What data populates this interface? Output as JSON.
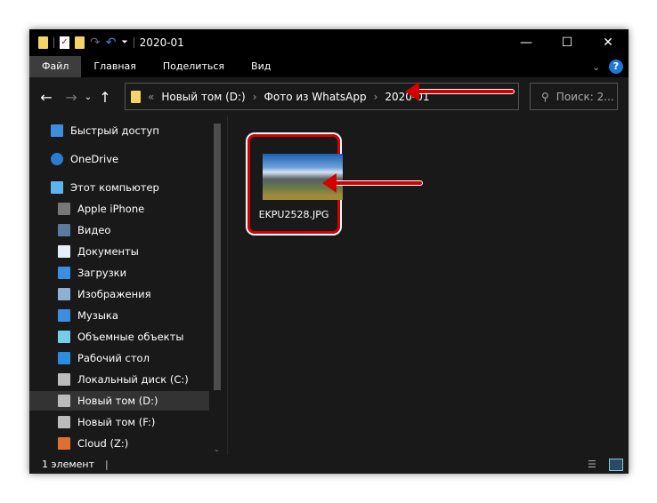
{
  "window": {
    "title": "2020-01",
    "minimize": "—",
    "maximize": "☐",
    "close": "✕"
  },
  "ribbon": {
    "tabs": [
      "Файл",
      "Главная",
      "Поделиться",
      "Вид"
    ],
    "help": "?",
    "expand": "⌄"
  },
  "address": {
    "back": "←",
    "forward": "→",
    "recent": "⌄",
    "up": "↑",
    "overflow": "«",
    "path": [
      "Новый том (D:)",
      "Фото из WhatsApp",
      "2020-01"
    ],
    "separator": "›",
    "search_placeholder": "Поиск: 2..."
  },
  "nav": {
    "items": [
      {
        "label": "Быстрый доступ",
        "icon": "star-icon",
        "color": "#3b8ee0"
      },
      {
        "label": "OneDrive",
        "icon": "cloud-icon",
        "color": "#2b7cd3"
      },
      {
        "label": "Этот компьютер",
        "icon": "computer-icon",
        "color": "#5fb4f0"
      },
      {
        "label": "Apple iPhone",
        "icon": "phone-icon",
        "color": "#777"
      },
      {
        "label": "Видео",
        "icon": "video-icon",
        "color": "#5a7aa0"
      },
      {
        "label": "Документы",
        "icon": "document-icon",
        "color": "#e8eef5"
      },
      {
        "label": "Загрузки",
        "icon": "download-icon",
        "color": "#3b8ee0"
      },
      {
        "label": "Изображения",
        "icon": "pictures-icon",
        "color": "#8fb0d0"
      },
      {
        "label": "Музыка",
        "icon": "music-icon",
        "color": "#3b8ee0"
      },
      {
        "label": "Объемные объекты",
        "icon": "cube-icon",
        "color": "#6fd0e8"
      },
      {
        "label": "Рабочий стол",
        "icon": "desktop-icon",
        "color": "#2b8de0"
      },
      {
        "label": "Локальный диск (C:)",
        "icon": "drive-icon",
        "color": "#bbb"
      },
      {
        "label": "Новый том (D:)",
        "icon": "drive-icon",
        "color": "#bbb",
        "selected": true
      },
      {
        "label": "Новый том (F:)",
        "icon": "drive-icon",
        "color": "#bbb"
      },
      {
        "label": "Cloud (Z:)",
        "icon": "cloud-drive-icon",
        "color": "#e07030"
      }
    ]
  },
  "files": [
    {
      "name": "EKPU2528.JPG"
    }
  ],
  "status": {
    "count": "1 элемент"
  },
  "colors": {
    "annotation": "#d40000",
    "folder": "#f4d36a",
    "accent": "#1e78d7"
  }
}
